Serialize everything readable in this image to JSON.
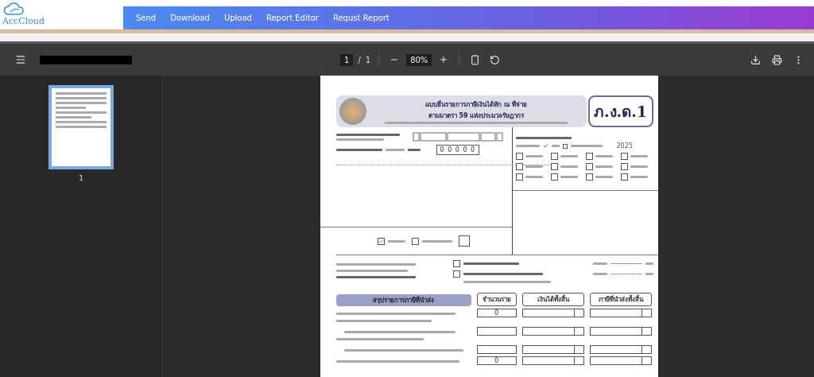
{
  "brand": {
    "name": "AccCloud"
  },
  "nav": [
    {
      "label": "Send"
    },
    {
      "label": "Download"
    },
    {
      "label": "Upload"
    },
    {
      "label": "Report Editor"
    },
    {
      "label": "Requst Report"
    }
  ],
  "viewer": {
    "page_current": "1",
    "separator": "/",
    "page_total": "1",
    "zoom": "80%"
  },
  "thumbnails": [
    {
      "label": "1",
      "selected": true
    }
  ],
  "form": {
    "title": "แบบยื่นรายการภาษีเงินได้หัก ณ ที่จ่าย",
    "subtitle": "ตามมาตรา 59 แห่งประมวลรัษฎากร",
    "code": "ภ.ง.ด.1",
    "branch_value": "0 0 0 0 0",
    "year": "2025",
    "months": [
      {
        "checked": false
      },
      {
        "checked": false
      },
      {
        "checked": false
      },
      {
        "checked": false
      },
      {
        "checked": false
      },
      {
        "checked": false
      },
      {
        "checked": false
      },
      {
        "checked": false
      },
      {
        "checked": false
      },
      {
        "checked": false
      },
      {
        "checked": false
      },
      {
        "checked": false
      }
    ],
    "filing": [
      {
        "checked": true
      },
      {
        "checked": false
      }
    ],
    "attachments": [
      {
        "checked": false
      },
      {
        "checked": false
      }
    ],
    "summary_heading": "สรุปรายการภาษีที่นำส่ง",
    "summary_columns": [
      "จำนวนราย",
      "เงินได้ทั้งสิ้น",
      "ภาษีที่นำส่งทั้งสิ้น"
    ],
    "summary_rows": [
      {
        "kind": "entry",
        "count": "0"
      },
      {
        "kind": "heading"
      },
      {
        "kind": "entry"
      },
      {
        "kind": "heading"
      },
      {
        "kind": "entry"
      },
      {
        "kind": "entry",
        "count": "0"
      }
    ]
  }
}
